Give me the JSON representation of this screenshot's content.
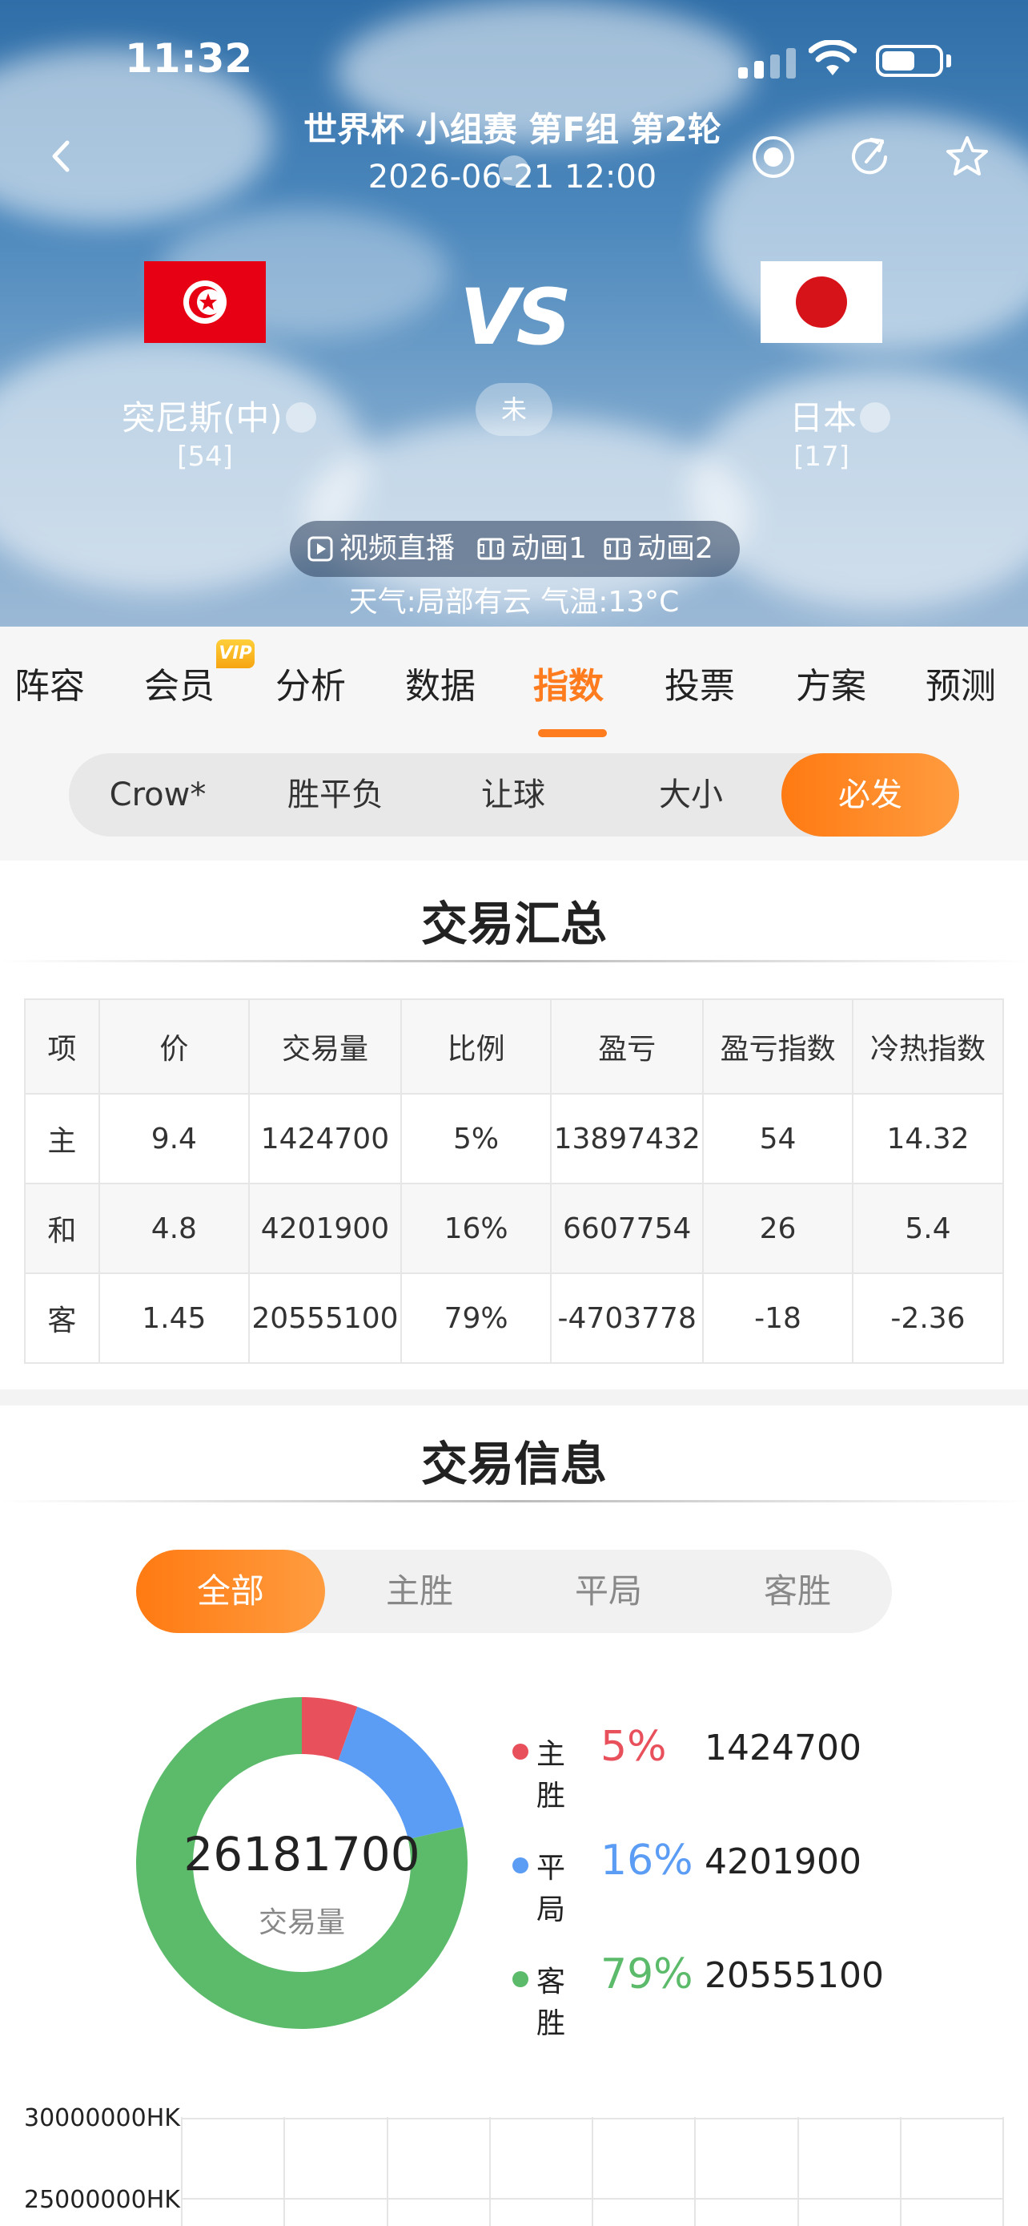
{
  "status_bar": {
    "time": "11:32"
  },
  "header": {
    "match_title": "世界杯 小组赛 第F组 第2轮",
    "match_time": "2026-06-21 12:00",
    "home_team": {
      "name": "突尼斯(中)",
      "rank": "[54]"
    },
    "away_team": {
      "name": "日本",
      "rank": "[17]"
    },
    "vs_text": "VS",
    "match_status": "未",
    "media": {
      "video": "视频直播",
      "anim1": "动画1",
      "anim2": "动画2"
    },
    "weather": "天气:局部有云  气温:13°C"
  },
  "tabs": [
    {
      "label": "阵容"
    },
    {
      "label": "会员"
    },
    {
      "label": "分析"
    },
    {
      "label": "数据"
    },
    {
      "label": "指数"
    },
    {
      "label": "投票"
    },
    {
      "label": "方案"
    },
    {
      "label": "预测"
    }
  ],
  "vip_badge": "VIP",
  "segments": [
    {
      "label": "Crow*"
    },
    {
      "label": "胜平负"
    },
    {
      "label": "让球"
    },
    {
      "label": "大小"
    },
    {
      "label": "必发"
    }
  ],
  "summary": {
    "title": "交易汇总",
    "headers": [
      "项",
      "价",
      "交易量",
      "比例",
      "盈亏",
      "盈亏指数",
      "冷热指数"
    ],
    "rows": [
      [
        "主",
        "9.4",
        "1424700",
        "5%",
        "13897432",
        "54",
        "14.32"
      ],
      [
        "和",
        "4.8",
        "4201900",
        "16%",
        "6607754",
        "26",
        "5.4"
      ],
      [
        "客",
        "1.45",
        "20555100",
        "79%",
        "-4703778",
        "-18",
        "-2.36"
      ]
    ]
  },
  "info": {
    "title": "交易信息",
    "tabs": [
      {
        "label": "全部"
      },
      {
        "label": "主胜"
      },
      {
        "label": "平局"
      },
      {
        "label": "客胜"
      }
    ]
  },
  "chart_data": [
    {
      "type": "pie",
      "subtype": "donut",
      "center_value": "26181700",
      "center_label": "交易量",
      "categories": [
        "主胜",
        "平局",
        "客胜"
      ],
      "values": [
        1424700,
        4201900,
        20555100
      ],
      "percent_labels": [
        "5%",
        "16%",
        "79%"
      ],
      "value_labels": [
        "1424700",
        "4201900",
        "20555100"
      ],
      "colors": [
        "#e8505b",
        "#5b9cf5",
        "#5cbb6b"
      ]
    },
    {
      "type": "bar",
      "ytick_labels": [
        "30000000HKS",
        "25000000HKS"
      ],
      "grid": true
    }
  ]
}
